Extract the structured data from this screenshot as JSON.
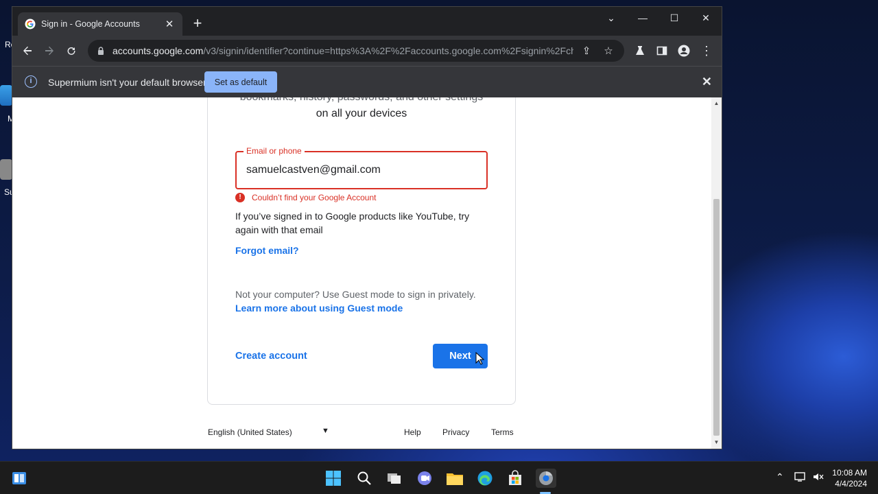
{
  "desktop": {
    "icon_labels": [
      "Re",
      "M",
      "Su"
    ]
  },
  "browser": {
    "tab": {
      "title": "Sign in - Google Accounts",
      "close": "✕"
    },
    "new_tab": "+",
    "window_controls": {
      "dropdown": "⌄",
      "minimize": "—",
      "maximize": "☐",
      "close": "✕"
    },
    "address": {
      "host": "accounts.google.com",
      "path": "/v3/signin/identifier?continue=https%3A%2F%2Faccounts.google.com%2Fsignin%2Fch..."
    },
    "infobar": {
      "message": "Supermium isn't your default browser",
      "button": "Set as default",
      "close": "✕"
    }
  },
  "signin": {
    "subtitle_partial": "bookmarks, history, passwords, and other settings",
    "subtitle_line2": "on all your devices",
    "email_label": "Email or phone",
    "email_value": "samuelcastven@gmail.com",
    "error": "Couldn’t find your Google Account",
    "help": "If you’ve signed in to Google products like YouTube, try again with that email",
    "forgot_email": "Forgot email?",
    "guest_text": "Not your computer? Use Guest mode to sign in privately.",
    "guest_link": "Learn more about using Guest mode",
    "create_account": "Create account",
    "next": "Next"
  },
  "footer": {
    "language": "English (United States)",
    "help": "Help",
    "privacy": "Privacy",
    "terms": "Terms"
  },
  "taskbar": {
    "time": "10:08 AM",
    "date": "4/4/2024"
  },
  "colors": {
    "accent": "#1a73e8",
    "error": "#d93025",
    "chrome_dark": "#35363a"
  }
}
